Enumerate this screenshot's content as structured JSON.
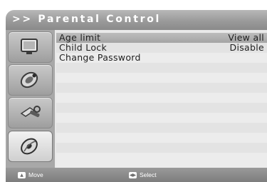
{
  "header": {
    "title": ">> Parental Control"
  },
  "sidebar": {
    "items": [
      {
        "icon": "tv-screen-icon",
        "active": false
      },
      {
        "icon": "satellite-dish-icon",
        "active": false
      },
      {
        "icon": "wrench-tools-icon",
        "active": false
      },
      {
        "icon": "disc-settings-icon",
        "active": true
      }
    ]
  },
  "menu": {
    "rows": [
      {
        "label": "Age limit",
        "value": "View all",
        "selected": true
      },
      {
        "label": "Child Lock",
        "value": "Disable",
        "selected": false
      },
      {
        "label": "Change Password",
        "value": "",
        "selected": false
      },
      {
        "label": "",
        "value": ""
      },
      {
        "label": "",
        "value": ""
      },
      {
        "label": "",
        "value": ""
      },
      {
        "label": "",
        "value": ""
      },
      {
        "label": "",
        "value": ""
      },
      {
        "label": "",
        "value": ""
      },
      {
        "label": "",
        "value": ""
      },
      {
        "label": "",
        "value": ""
      },
      {
        "label": "",
        "value": ""
      },
      {
        "label": "",
        "value": ""
      }
    ]
  },
  "footer": {
    "hints": [
      {
        "key_icon": "up-down-key-icon",
        "label": "Move"
      },
      {
        "key_icon": "ok-key-icon",
        "label": "Select"
      }
    ]
  },
  "colors": {
    "title_text": "#ffffff",
    "selected_row": "#b0b0b0",
    "panel_background": "#e9e9e9"
  }
}
